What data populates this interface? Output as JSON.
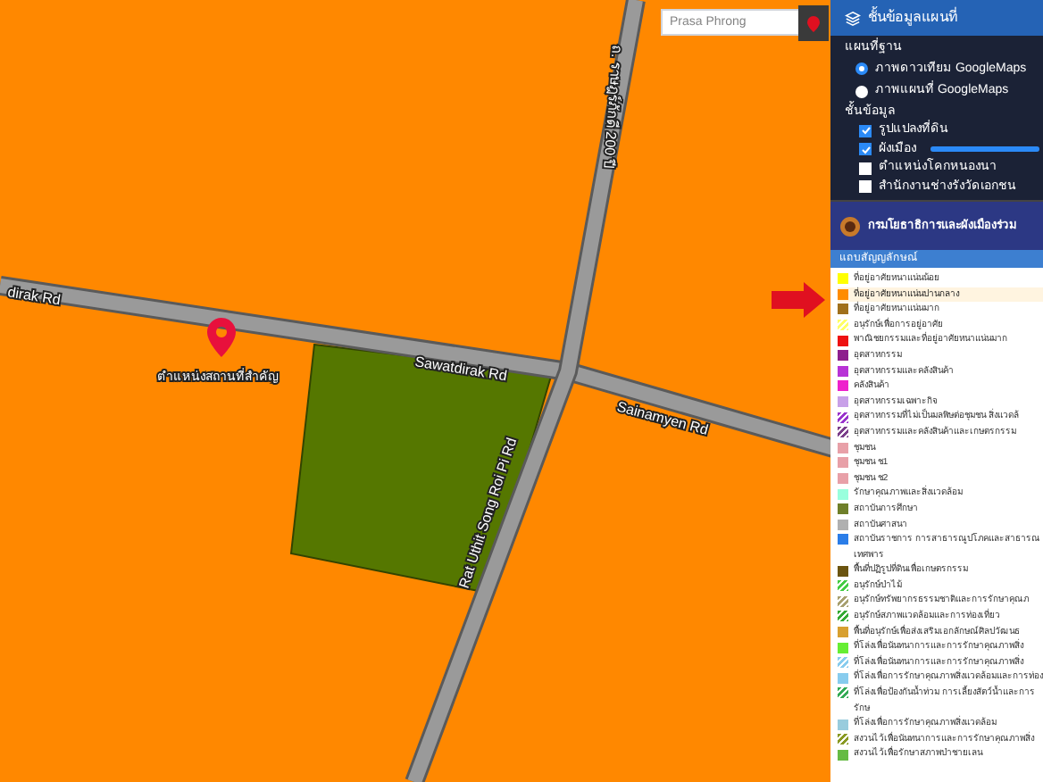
{
  "map": {
    "search": {
      "placeholder": "Prasa Phrong"
    },
    "roads": [
      {
        "label": "dirak Rd"
      },
      {
        "label": "Sawatdirak Rd"
      },
      {
        "label": "Sainamyen Rd"
      },
      {
        "label": "ถ. ราษฎร์ภักดี 200 ปี"
      },
      {
        "label": "Rat Uthit Song Roi Pi Rd"
      }
    ],
    "marker": {
      "label": "ตำแหน่งสถานที่สำคัญ"
    }
  },
  "panel": {
    "title": "ชั้นข้อมูลแผนที่",
    "basemap_heading": "แผนที่ฐาน",
    "basemaps": [
      {
        "label": "ภาพดาวเทียม GoogleMaps",
        "selected": true
      },
      {
        "label": "ภาพแผนที่ GoogleMaps",
        "selected": false
      }
    ],
    "layers_heading": "ชั้นข้อมูล",
    "layers": [
      {
        "label": "รูปแปลงที่ดิน",
        "checked": true
      },
      {
        "label": "ผังเมือง",
        "checked": true,
        "level": 1
      },
      {
        "label": "ตำแหน่งโคกหนองนา",
        "checked": false
      },
      {
        "label": "สำนักงานช่างรังวัดเอกชน",
        "checked": false
      }
    ],
    "agency": "กรมโยธาธิการและผังเมืองร่วม"
  },
  "legend": {
    "title": "แถบสัญญลักษณ์",
    "items": [
      {
        "label": "ที่อยู่อาศัยหนาแน่นน้อย",
        "color": "#ffff00",
        "kind": "solid",
        "selected": false
      },
      {
        "label": "ที่อยู่อาศัยหนาแน่นปานกลาง",
        "color": "#ff8c00",
        "kind": "solid",
        "selected": true
      },
      {
        "label": "ที่อยู่อาศัยหนาแน่นมาก",
        "color": "#a0701c",
        "kind": "solid",
        "selected": false
      },
      {
        "label": "อนุรักษ์เพื่อการอยู่อาศัย",
        "color": "#ffff66",
        "kind": "hatched",
        "selected": false
      },
      {
        "label": "พาณิชยกรรมและที่อยู่อาศัยหนาแน่นมาก",
        "color": "#ee1111",
        "kind": "solid",
        "selected": false
      },
      {
        "label": "อุตสาหกรรม",
        "color": "#8e1e8e",
        "kind": "solid",
        "selected": false
      },
      {
        "label": "อุตสาหกรรมและคลังสินค้า",
        "color": "#b833d6",
        "kind": "solid",
        "selected": false
      },
      {
        "label": "คลังสินค้า",
        "color": "#ee22cc",
        "kind": "solid",
        "selected": false
      },
      {
        "label": "อุตสาหกรรมเฉพาะกิจ",
        "color": "#c8a0e8",
        "kind": "solid",
        "selected": false
      },
      {
        "label": "อุตสาหกรรมที่ไม่เป็นมลพิษต่อชุมชน สิ่งแวดล้",
        "color": "#9933cc",
        "kind": "hatched",
        "selected": false
      },
      {
        "label": "อุตสาหกรรมและคลังสินค้าและเกษตรกรรม",
        "color": "#7a3d8a",
        "kind": "hatched",
        "selected": false
      },
      {
        "label": "ชุมชน",
        "color": "#e8a0a8",
        "kind": "solid",
        "selected": false
      },
      {
        "label": "ชุมชน ช1",
        "color": "#e8a0a8",
        "kind": "solid",
        "selected": false
      },
      {
        "label": "ชุมชน ช2",
        "color": "#e8a0a8",
        "kind": "solid",
        "selected": false
      },
      {
        "label": "รักษาคุณภาพและสิ่งแวดล้อม",
        "color": "#99ffdd",
        "kind": "solid",
        "selected": false
      },
      {
        "label": "สถาบันการศึกษา",
        "color": "#6f7f2a",
        "kind": "solid",
        "selected": false
      },
      {
        "label": "สถาบันศาสนา",
        "color": "#b0b0b0",
        "kind": "solid",
        "selected": false
      },
      {
        "label": "สถาบันราชการ การสาธารณูปโภคและสาธารณ เทศพาร",
        "color": "#2b7de8",
        "kind": "solid",
        "selected": false
      },
      {
        "label": "พื้นที่ปฏิรูปที่ดินเพื่อเกษตรกรรม",
        "color": "#6b5410",
        "kind": "solid",
        "selected": false
      },
      {
        "label": "อนุรักษ์ป่าไม้",
        "color": "#44cc44",
        "kind": "hatched",
        "selected": false
      },
      {
        "label": "อนุรักษ์ทรัพยากรธรรมชาติและการรักษาคุณภ",
        "color": "#a8a070",
        "kind": "hatched",
        "selected": false
      },
      {
        "label": "อนุรักษ์สภาพแวดล้อมและการท่องเที่ยว",
        "color": "#33aa33",
        "kind": "hatched",
        "selected": false
      },
      {
        "label": "พื้นที่อนุรักษ์เพื่อส่งเสริมเอกลักษณ์ศิลปวัฒนธ",
        "color": "#d8a030",
        "kind": "solid",
        "selected": false
      },
      {
        "label": "ที่โล่งเพื่อนันทนาการและการรักษาคุณภาพสิ่ง",
        "color": "#66ee33",
        "kind": "solid",
        "selected": false
      },
      {
        "label": "ที่โล่งเพื่อนันทนาการและการรักษาคุณภาพสิ่ง",
        "color": "#88ccee",
        "kind": "hatched",
        "selected": false
      },
      {
        "label": "ที่โล่งเพื่อการรักษาคุณภาพสิ่งแวดล้อมและการท่อง",
        "color": "#88ccee",
        "kind": "solid",
        "selected": false
      },
      {
        "label": "ที่โล่งเพื่อป้องกันน้ำท่วม การเลี้ยงสัตว์น้ำและการรักษ",
        "color": "#33aa55",
        "kind": "hatched",
        "selected": false
      },
      {
        "label": "ที่โล่งเพื่อการรักษาคุณภาพสิ่งแวดล้อม",
        "color": "#99ccdd",
        "kind": "solid",
        "selected": false
      },
      {
        "label": "สงวนไว้เพื่อนันทนาการและการรักษาคุณภาพสิ่ง",
        "color": "#889922",
        "kind": "hatched",
        "selected": false
      },
      {
        "label": "สงวนไว้เพื่อรักษาสภาพป่าชายเลน",
        "color": "#66bb44",
        "kind": "solid",
        "selected": false
      }
    ]
  }
}
